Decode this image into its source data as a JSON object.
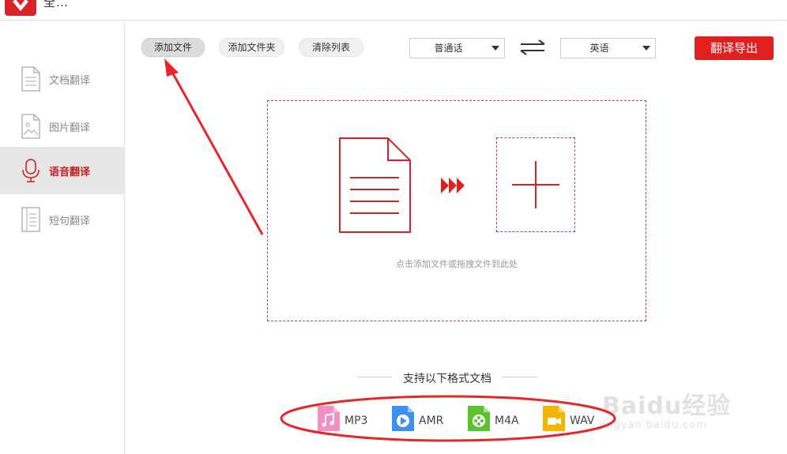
{
  "app": {
    "title": "全…"
  },
  "sidebar": {
    "items": [
      {
        "label": "文档翻译",
        "icon": "document-icon",
        "active": false
      },
      {
        "label": "图片翻译",
        "icon": "image-icon",
        "active": false
      },
      {
        "label": "语音翻译",
        "icon": "microphone-icon",
        "active": true
      },
      {
        "label": "短句翻译",
        "icon": "text-lines-icon",
        "active": false
      }
    ]
  },
  "toolbar": {
    "add_file": "添加文件",
    "add_folder": "添加文件夹",
    "clear_list": "清除列表",
    "source_language": "普通话",
    "target_language": "英语",
    "export": "翻译导出"
  },
  "dropzone": {
    "hint": "点击添加文件或拖拽文件到此处"
  },
  "formats": {
    "title": "支持以下格式文档",
    "items": [
      {
        "name": "MP3",
        "icon": "music-file-icon",
        "color": "#f48fc6"
      },
      {
        "name": "AMR",
        "icon": "play-file-icon",
        "color": "#3d8ff0"
      },
      {
        "name": "M4A",
        "icon": "film-reel-file-icon",
        "color": "#5cc22f"
      },
      {
        "name": "WAV",
        "icon": "video-file-icon",
        "color": "#f5b400"
      }
    ]
  },
  "watermark": {
    "brand": "Baidu经验",
    "url": "jingyan.baidu.com"
  },
  "colors": {
    "accent": "#e0201f",
    "annotation": "#e8262a"
  }
}
